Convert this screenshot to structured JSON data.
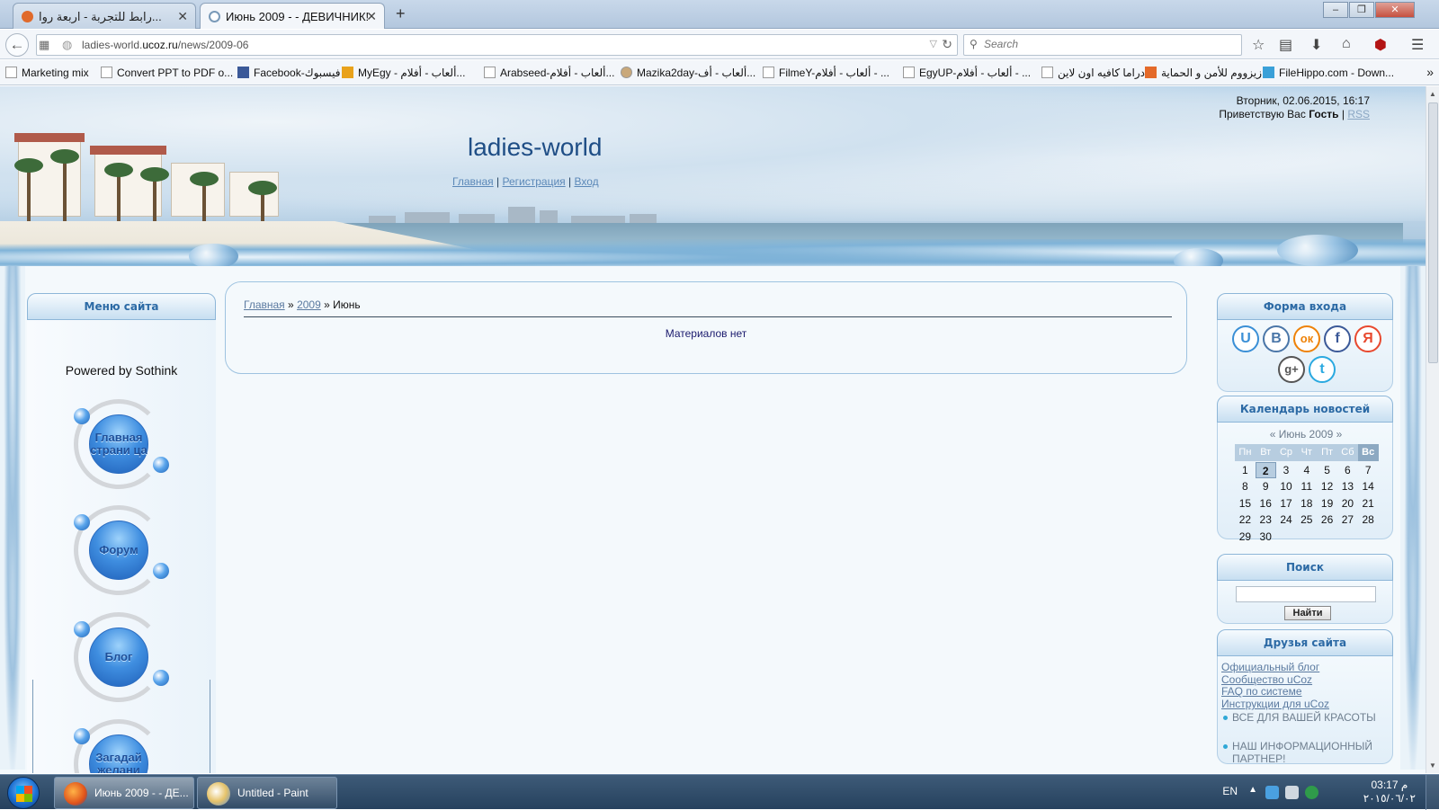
{
  "browser": {
    "tabs": [
      {
        "title": "رابط للتجربة - اربعة روا...",
        "active": false
      },
      {
        "title": "Июнь 2009 - - ДЕВИЧНИК!",
        "active": true
      }
    ],
    "url_prefix": "ladies-world.",
    "url_domain": "ucoz.ru",
    "url_path": "/news/2009-06",
    "search_placeholder": "Search",
    "bookmarks": [
      "Marketing mix",
      "Convert PPT to PDF o...",
      "Facebook-فيسبوك",
      "MyEgy - ألعاب - أفلام...",
      "Arabseed-ألعاب - أفلام...",
      "Mazika2day-ألعاب - أف...",
      "FilmeY-ألعاب - أفلام - ...",
      "EgyUP-ألعاب - أفلام - ...",
      "دراما كافيه اون لاين",
      "زيزووم للأمن و الحماية",
      "FileHippo.com - Down..."
    ],
    "more_glyph": "»"
  },
  "header": {
    "site_title": "ladies-world",
    "nav": [
      "Главная",
      "Регистрация",
      "Вход"
    ],
    "nav_separator": "|",
    "datetime": "Вторник, 02.06.2015, 16:17",
    "greeting": "Приветствую Вас",
    "guest": "Гость",
    "rss": "RSS"
  },
  "left": {
    "menu_title": "Меню сайта",
    "powered": "Powered by Sothink",
    "buttons": [
      "Главная страни ца",
      "Форум",
      "Блог",
      "Загадай желани"
    ]
  },
  "content": {
    "breadcrumb": [
      "Главная",
      "2009",
      "Июнь"
    ],
    "breadcrumb_sep": "»",
    "empty_message": "Материалов нет"
  },
  "right": {
    "login_title": "Форма входа",
    "social": [
      {
        "icon": "ucoz-icon",
        "glyph": "U",
        "color": "#3a8fd6"
      },
      {
        "icon": "vk-icon",
        "glyph": "В",
        "color": "#4a76a8"
      },
      {
        "icon": "odnoklassniki-icon",
        "glyph": "ок",
        "color": "#ee8208"
      },
      {
        "icon": "facebook-icon",
        "glyph": "f",
        "color": "#3b5998"
      },
      {
        "icon": "yandex-icon",
        "glyph": "Я",
        "color": "#e8492f"
      },
      {
        "icon": "google-plus-icon",
        "glyph": "g+",
        "color": "#555555"
      },
      {
        "icon": "twitter-icon",
        "glyph": "t",
        "color": "#2aa9e0"
      }
    ],
    "calendar_title": "Календарь новостей",
    "calendar_month": "Июнь 2009",
    "calendar_prev": "«",
    "calendar_next": "»",
    "weekdays": [
      "Пн",
      "Вт",
      "Ср",
      "Чт",
      "Пт",
      "Сб",
      "Вс"
    ],
    "weeks": [
      [
        "1",
        "2",
        "3",
        "4",
        "5",
        "6",
        "7"
      ],
      [
        "8",
        "9",
        "10",
        "11",
        "12",
        "13",
        "14"
      ],
      [
        "15",
        "16",
        "17",
        "18",
        "19",
        "20",
        "21"
      ],
      [
        "22",
        "23",
        "24",
        "25",
        "26",
        "27",
        "28"
      ],
      [
        "29",
        "30",
        "",
        "",
        "",
        "",
        ""
      ]
    ],
    "calendar_today": "2",
    "search_title": "Поиск",
    "search_button": "Найти",
    "friends_title": "Друзья сайта",
    "friend_links": [
      "Официальный блог",
      "Сообщество uCoz",
      "FAQ по системе",
      "Инструкции для uCoz"
    ],
    "friend_items": [
      "ВСЕ ДЛЯ ВАШЕЙ КРАСОТЫ",
      "НАШ ИНФОРМАЦИОННЫЙ ПАРТНЕР!"
    ]
  },
  "taskbar": {
    "items": [
      {
        "label": "Июнь 2009 - - ДЕ...",
        "icon": "firefox-icon",
        "active": true
      },
      {
        "label": "Untitled - Paint",
        "icon": "paint-icon",
        "active": false
      }
    ],
    "language": "EN",
    "time": "03:17 م",
    "date": "٢٠١٥/٠٦/٠٢"
  }
}
